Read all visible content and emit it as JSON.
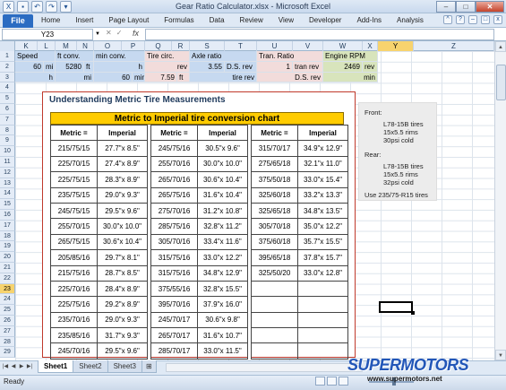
{
  "window": {
    "title": "Gear Ratio Calculator.xlsx - Microsoft Excel"
  },
  "ribbon": {
    "file": "File",
    "tabs": [
      "Home",
      "Insert",
      "Page Layout",
      "Formulas",
      "Data",
      "Review",
      "View",
      "Developer",
      "Add-Ins",
      "Analysis"
    ]
  },
  "formula_bar": {
    "name_box": "Y23",
    "fx": "fx",
    "value": ""
  },
  "columns": [
    "K",
    "L",
    "M",
    "N",
    "O",
    "P",
    "Q",
    "R",
    "S",
    "T",
    "U",
    "V",
    "W",
    "X",
    "Y",
    "Z"
  ],
  "selected_column": "Y",
  "rows": [
    "1",
    "2",
    "3",
    "4",
    "5",
    "6",
    "7",
    "8",
    "9",
    "10",
    "11",
    "12",
    "13",
    "14",
    "15",
    "16",
    "17",
    "18",
    "19",
    "20",
    "21",
    "22",
    "23",
    "24",
    "25",
    "26",
    "27",
    "28",
    "29"
  ],
  "selected_row": "23",
  "header_cells": {
    "speed": "Speed",
    "ft_conv": "ft conv.",
    "min_conv": "min conv.",
    "tire_circ": "Tire circ.",
    "axle_ratio": "Axle ratio",
    "tran_ratio": "Tran. Ratio",
    "engine_rpm": "Engine RPM",
    "r2_speed": "60",
    "r2_speed_unit": "mi",
    "r2_ft": "5280",
    "r2_ft_unit": "ft",
    "r2_min_unit": "h",
    "r2_tire_unit": "rev",
    "r2_axle": "3.55",
    "r2_axle_unit": "D.S. rev",
    "r2_tran": "1",
    "r2_tran_unit": "tran rev",
    "r2_rpm": "2469",
    "r2_rpm_unit": "rev",
    "r3_speed": "h",
    "r3_ft": "mi",
    "r3_min": "60",
    "r3_min_unit": "min",
    "r3_tire": "7.59",
    "r3_tire_unit": "ft",
    "r3_axle_unit": "tire rev",
    "r3_tran_unit": "D.S. rev",
    "r3_rpm_unit": "min"
  },
  "picture": {
    "title": "Understanding Metric Tire Measurements",
    "chart_title": "Metric to Imperial tire conversion chart",
    "col_headers": [
      "Metric =",
      "Imperial",
      "Metric =",
      "Imperial",
      "Metric =",
      "Imperial"
    ],
    "rows": [
      [
        "215/75/15",
        "27.7\"x 8.5\"",
        "245/75/16",
        "30.5\"x 9.6\"",
        "315/70/17",
        "34.9\"x 12.9\""
      ],
      [
        "225/70/15",
        "27.4\"x 8.9\"",
        "255/70/16",
        "30.0\"x 10.0\"",
        "275/65/18",
        "32.1\"x 11.0\""
      ],
      [
        "225/75/15",
        "28.3\"x 8.9\"",
        "265/70/16",
        "30.6\"x 10.4\"",
        "375/50/18",
        "33.0\"x 15.4\""
      ],
      [
        "235/75/15",
        "29.0\"x 9.3\"",
        "265/75/16",
        "31.6\"x 10.4\"",
        "325/60/18",
        "33.2\"x 13.3\""
      ],
      [
        "245/75/15",
        "29.5\"x 9.6\"",
        "275/70/16",
        "31.2\"x 10.8\"",
        "325/65/18",
        "34.8\"x 13.5\""
      ],
      [
        "255/70/15",
        "30.0\"x 10.0\"",
        "285/75/16",
        "32.8\"x 11.2\"",
        "305/70/18",
        "35.0\"x 12.2\""
      ],
      [
        "265/75/15",
        "30.6\"x 10.4\"",
        "305/70/16",
        "33.4\"x 11.6\"",
        "375/60/18",
        "35.7\"x 15.5\""
      ],
      [
        "205/85/16",
        "29.7\"x 8.1\"",
        "315/75/16",
        "33.0\"x 12.2\"",
        "395/65/18",
        "37.8\"x 15.7\""
      ],
      [
        "215/75/16",
        "28.7\"x 8.5\"",
        "315/75/16",
        "34.8\"x 12.9\"",
        "325/50/20",
        "33.0\"x 12.8\""
      ],
      [
        "225/70/16",
        "28.4\"x 8.9\"",
        "375/55/16",
        "32.8\"x 15.5\"",
        "",
        ""
      ],
      [
        "225/75/16",
        "29.2\"x 8.9\"",
        "395/70/16",
        "37.9\"x 16.0\"",
        "",
        ""
      ],
      [
        "235/70/16",
        "29.0\"x 9.3\"",
        "245/70/17",
        "30.6\"x 9.8\"",
        "",
        ""
      ],
      [
        "235/85/16",
        "31.7\"x 9.3\"",
        "265/70/17",
        "31.6\"x 10.7\"",
        "",
        ""
      ],
      [
        "245/70/16",
        "29.5\"x 9.6\"",
        "285/70/17",
        "33.0\"x 11.5\"",
        "",
        ""
      ]
    ]
  },
  "notes": {
    "front_label": "Front:",
    "front_1": "L78-15B tires",
    "front_2": "15x5.5 rims",
    "front_3": "30psi cold",
    "rear_label": "Rear:",
    "rear_1": "L78-15B tires",
    "rear_2": "15x5.5 rims",
    "rear_3": "32psi cold",
    "use": "Use 235/75-R15 tires"
  },
  "sheets": [
    "Sheet1",
    "Sheet2",
    "Sheet3"
  ],
  "active_sheet": "Sheet1",
  "status": {
    "ready": "Ready"
  },
  "watermark": {
    "brand": "SUPERMOTORS",
    "url": "www.supermotors.net"
  },
  "colors": {
    "file_tab": "#2b6cc2",
    "chart_header": "#ffcc00",
    "picture_border": "#c0392b",
    "selection": "#f7d36e"
  }
}
